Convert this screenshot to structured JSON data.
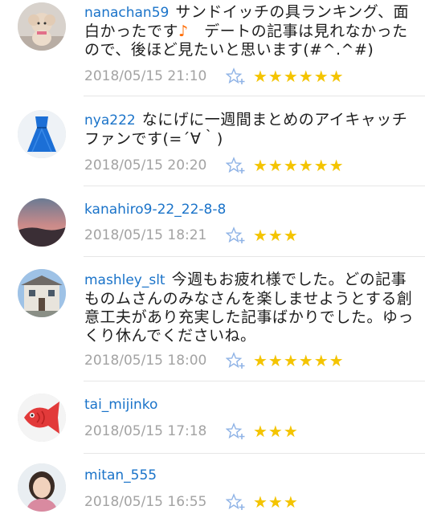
{
  "comments": [
    {
      "user": "nanachan59",
      "text_before": "サンドイッチの具ランキング、面白かったです",
      "note": "♪",
      "text_after": "　デートの記事は見れなかったので、後ほど見たいと思います(#^.^#)",
      "date": "2018/05/15 21:10",
      "stars": "★★★★★★",
      "avatar": "dog"
    },
    {
      "user": "nya222",
      "text_before": "なにげに一週間まとめのアイキャッチファンです(=´∀｀)",
      "note": "",
      "text_after": "",
      "date": "2018/05/15 20:20",
      "stars": "★★★★★★",
      "avatar": "dress"
    },
    {
      "user": "kanahiro9-22_22-8-8",
      "text_before": "",
      "note": "",
      "text_after": "",
      "date": "2018/05/15 18:21",
      "stars": "★★★",
      "avatar": "sunset"
    },
    {
      "user": "mashley_slt",
      "text_before": "今週もお疲れ様でした。どの記事ものムさんのみなさんを楽しませようとする創意工夫があり充実した記事ばかりでした。ゆっくり休んでくださいね。",
      "note": "",
      "text_after": "",
      "date": "2018/05/15 18:00",
      "stars": "★★★★★★",
      "avatar": "house"
    },
    {
      "user": "tai_mijinko",
      "text_before": "",
      "note": "",
      "text_after": "",
      "date": "2018/05/15 17:18",
      "stars": "★★★",
      "avatar": "fish"
    },
    {
      "user": "mitan_555",
      "text_before": "",
      "note": "",
      "text_after": "",
      "date": "2018/05/15 16:55",
      "stars": "★★★",
      "avatar": "person"
    }
  ],
  "colors": {
    "username": "#1a73c9",
    "date": "#a3a3a3",
    "star": "#f4c400",
    "note": "#ff6a00"
  },
  "icons": {
    "add_star": "star-plus-icon"
  }
}
